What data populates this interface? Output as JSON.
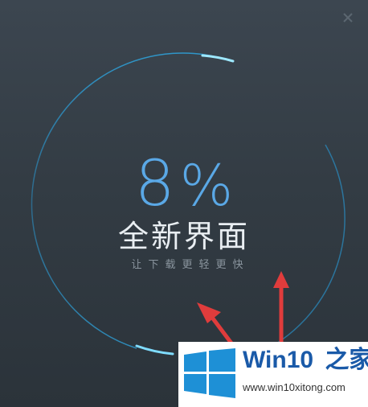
{
  "window": {
    "close_label": "×"
  },
  "progress": {
    "value": 8,
    "unit": "%"
  },
  "headline": "全新界面",
  "tagline": "让下载更轻更快",
  "watermark": {
    "brand": "Win10",
    "brand_suffix": "之家",
    "url": "www.win10xitong.com"
  },
  "colors": {
    "background": "#333c44",
    "accent": "#5aa8e6",
    "ring": "#2a8ec4",
    "arrow": "#e03c3c",
    "watermark_blue": "#1a5aa8"
  }
}
